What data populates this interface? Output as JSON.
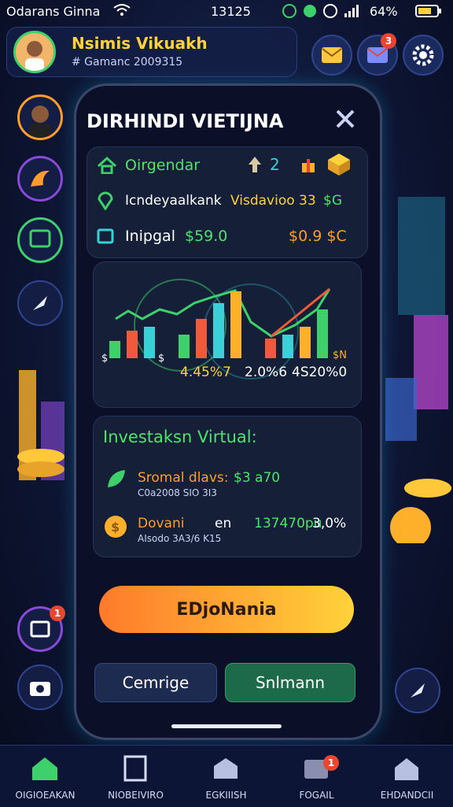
{
  "status_bar": {
    "carrier": "Odarans Ginna",
    "time": "13125",
    "battery": "64%"
  },
  "header": {
    "name": "Nsimis Vikuakh",
    "subtitle": "# Gamanc 2009315"
  },
  "top_actions": {
    "notification_count": "3"
  },
  "dialog": {
    "title": "DIRHINDI VIETIJNA",
    "row1": {
      "label": "Oirgendar",
      "up_value": "2"
    },
    "row2": {
      "label": "Icndeyaalkank",
      "value": "Visdavioo 33",
      "value2": "$G"
    },
    "row3": {
      "label": "Inipgal",
      "value": "$59.0",
      "value2": "$0.9 $C"
    }
  },
  "chart_data": {
    "type": "bar",
    "labels": {
      "left_axis": "$",
      "mid_axis": "$",
      "right_axis": "$N",
      "stat1": "4.45%7",
      "stat2": "2.0%6",
      "stat3": "4S20%0"
    },
    "values": [
      22,
      35,
      40,
      0,
      30,
      50,
      70,
      85,
      0,
      25,
      30,
      40,
      62
    ],
    "series_colors": [
      "#3ed06a",
      "#f05a3a",
      "#3ad0d8",
      "#ffb02a"
    ]
  },
  "investments": {
    "title": "Investaksn Virtual:",
    "items": [
      {
        "name": "Sromal dlavs:",
        "value": "$3 a70",
        "sub": "C0a2008 SIO 3I3"
      },
      {
        "name": "Dovani",
        "mid": "en",
        "value": "137470pu",
        "value2": "3,0%",
        "sub": "AIsodo 3A3/6 K15"
      }
    ]
  },
  "buttons": {
    "main": "EDjoNania",
    "left": "Cemrige",
    "right": "Snlmann"
  },
  "side_badges": {
    "message_count": "1"
  },
  "bottom_nav": {
    "items": [
      {
        "label": "OIGIOEAKAN",
        "active": true
      },
      {
        "label": "NIOBEIVIRO",
        "active": false
      },
      {
        "label": "EGKIIISH",
        "active": false
      },
      {
        "label": "FOGAIL",
        "active": false,
        "badge": "1"
      },
      {
        "label": "EHDANDCII",
        "active": false
      }
    ]
  }
}
